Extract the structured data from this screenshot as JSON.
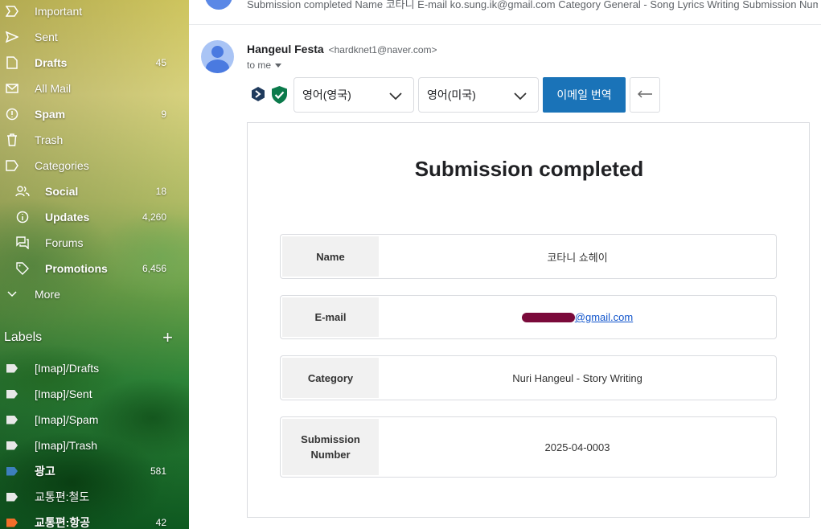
{
  "sidebar": {
    "items": [
      {
        "label": "Important",
        "count": "",
        "icon": "important-icon"
      },
      {
        "label": "Sent",
        "count": "",
        "icon": "sent-icon"
      },
      {
        "label": "Drafts",
        "count": "45",
        "icon": "draft-icon"
      },
      {
        "label": "All Mail",
        "count": "",
        "icon": "all-mail-icon"
      },
      {
        "label": "Spam",
        "count": "9",
        "icon": "spam-icon"
      },
      {
        "label": "Trash",
        "count": "",
        "icon": "trash-icon"
      },
      {
        "label": "Categories",
        "count": "",
        "icon": "label-icon"
      },
      {
        "label": "Social",
        "count": "18",
        "icon": "people-icon"
      },
      {
        "label": "Updates",
        "count": "4,260",
        "icon": "info-icon"
      },
      {
        "label": "Forums",
        "count": "",
        "icon": "forum-icon"
      },
      {
        "label": "Promotions",
        "count": "6,456",
        "icon": "tag-icon"
      },
      {
        "label": "More",
        "count": "",
        "icon": "chevron-down-icon"
      }
    ],
    "labels_header": "Labels",
    "labels_add": "+",
    "labels": [
      {
        "label": "[Imap]/Drafts",
        "count": "",
        "color": "#e8e8e8"
      },
      {
        "label": "[Imap]/Sent",
        "count": "",
        "color": "#e8e8e8"
      },
      {
        "label": "[Imap]/Spam",
        "count": "",
        "color": "#e8e8e8"
      },
      {
        "label": "[Imap]/Trash",
        "count": "",
        "color": "#e8e8e8"
      },
      {
        "label": "광고",
        "count": "581",
        "color": "#3d7fbd"
      },
      {
        "label": "교통편:철도",
        "count": "",
        "color": "#e8e8e8"
      },
      {
        "label": "교통편:항공",
        "count": "42",
        "color": "#f26e2a"
      }
    ]
  },
  "thread": {
    "preview_text": "Submission completed Name 코타니 E-mail ko.sung.ik@gmail.com Category General - Song Lyrics Writing Submission Number"
  },
  "message": {
    "sender_name": "Hangeul Festa",
    "sender_email": "<hardknet1@naver.com>",
    "to_line": "to me",
    "translate": {
      "source_language": "영어(영국)",
      "target_language": "영어(미국)",
      "translate_button": "이메일 번역",
      "back_arrow": "←"
    },
    "body": {
      "title": "Submission completed",
      "fields": [
        {
          "key": "Name",
          "value": "코타니 쇼헤이"
        },
        {
          "key": "E-mail",
          "value": "@gmail.com"
        },
        {
          "key": "Category",
          "value": "Nuri Hangeul - Story Writing"
        },
        {
          "key": "Submission Number",
          "value": "2025-04-0003"
        }
      ]
    }
  },
  "colors": {
    "translate_button": "#1a73b8",
    "redaction": "#7a0a3a",
    "link": "#1155cc"
  }
}
